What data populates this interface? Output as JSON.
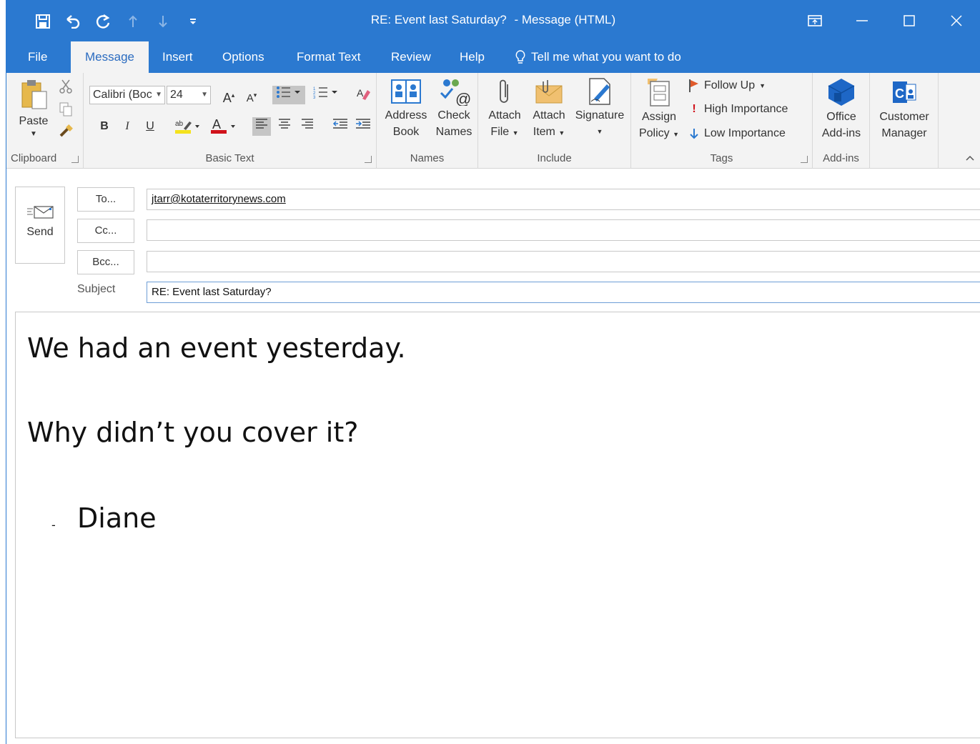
{
  "window": {
    "title": "RE: Event last Saturday?",
    "title_suffix": "-  Message (HTML)"
  },
  "qat": {
    "icons": [
      "save-icon",
      "undo-icon",
      "redo-icon",
      "previous-item-icon",
      "next-item-icon",
      "customize-qat-icon"
    ]
  },
  "tabs": [
    {
      "label": "File"
    },
    {
      "label": "Message",
      "active": true
    },
    {
      "label": "Insert"
    },
    {
      "label": "Options"
    },
    {
      "label": "Format Text"
    },
    {
      "label": "Review"
    },
    {
      "label": "Help"
    }
  ],
  "tellme": {
    "label": "Tell me what you want to do"
  },
  "ribbon": {
    "clipboard": {
      "label": "Clipboard",
      "paste": "Paste"
    },
    "basic_text": {
      "label": "Basic Text",
      "font_name": "Calibri (Boc",
      "font_size": "24",
      "bold": "B",
      "italic": "I",
      "underline": "U"
    },
    "names": {
      "label": "Names",
      "address_book_1": "Address",
      "address_book_2": "Book",
      "check_names_1": "Check",
      "check_names_2": "Names"
    },
    "include": {
      "label": "Include",
      "attach_file_1": "Attach",
      "attach_file_2": "File",
      "attach_item_1": "Attach",
      "attach_item_2": "Item",
      "signature": "Signature"
    },
    "tags": {
      "label": "Tags",
      "assign_policy_1": "Assign",
      "assign_policy_2": "Policy",
      "follow_up": "Follow Up",
      "high_importance": "High Importance",
      "low_importance": "Low Importance"
    },
    "addins": {
      "label": "Add-ins",
      "office_addins_1": "Office",
      "office_addins_2": "Add-ins"
    },
    "customer_manager": {
      "label_1": "Customer",
      "label_2": "Manager"
    }
  },
  "compose": {
    "send": "Send",
    "to_button": "To...",
    "cc_button": "Cc...",
    "bcc_button": "Bcc...",
    "to_value": "jtarr@kotaterritorynews.com",
    "cc_value": "",
    "bcc_value": "",
    "subject_label": "Subject",
    "subject_value": "RE: Event last Saturday?"
  },
  "body": {
    "line1": "We had an event yesterday.",
    "line2": "Why didn’t you cover it?",
    "sig_dash": "-",
    "signature": "Diane"
  },
  "colors": {
    "accent": "#2b79d0",
    "ribbon_bg": "#f3f3f3",
    "active_tab_text": "#2b6cc0"
  }
}
